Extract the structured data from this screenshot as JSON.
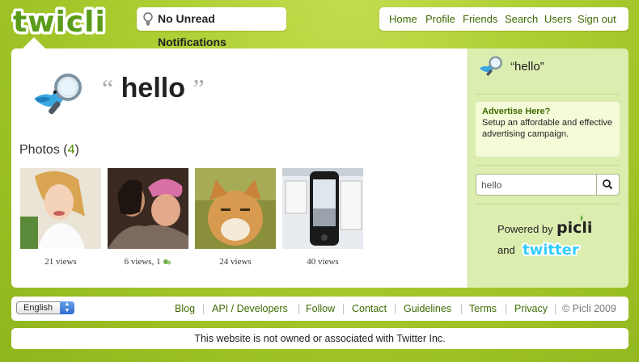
{
  "brand": {
    "logo_text": "twicli"
  },
  "notification": {
    "label": "No Unread Notifications"
  },
  "top_nav": [
    "Home",
    "Profile",
    "Friends",
    "Search",
    "Users",
    "Sign out"
  ],
  "profile": {
    "title": "hello",
    "photos_label": "Photos",
    "photos_count": "4"
  },
  "photos": [
    {
      "caption": "21 views"
    },
    {
      "caption": "6 views, 1"
    },
    {
      "caption": "24 views"
    },
    {
      "caption": "40 views"
    }
  ],
  "sidebar": {
    "title": "“hello”",
    "ad": {
      "title": "Advertise Here?",
      "body": "Setup an affordable and effective advertising campaign."
    },
    "search": {
      "value": "hello"
    },
    "powered_by": "Powered by",
    "powered_logo": "picli",
    "and": "and",
    "and_logo": "twitter"
  },
  "footer": {
    "language": "English",
    "links": [
      "Blog",
      "API / Developers",
      "Follow",
      "Contact",
      "Guidelines",
      "Terms",
      "Privacy"
    ],
    "copyright": "© Picli 2009"
  },
  "disclaimer": "This website is not owned or associated with Twitter Inc.",
  "colors": {
    "accent": "#3d6b00",
    "background": "#a9cc2f",
    "sidebar": "#dcedb0"
  }
}
